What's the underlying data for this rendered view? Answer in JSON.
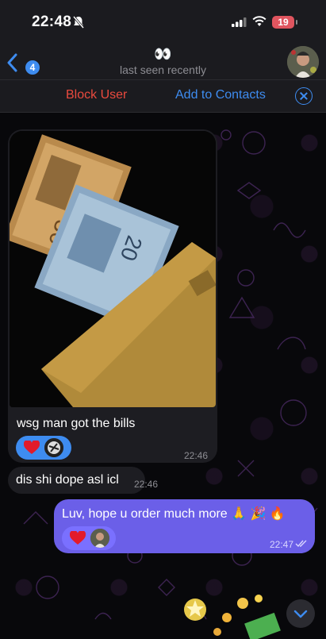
{
  "status_bar": {
    "time": "22:48",
    "battery": "19"
  },
  "nav": {
    "back_count": "4",
    "title": "👀",
    "subtitle": "last seen recently"
  },
  "action_bar": {
    "block_label": "Block User",
    "add_label": "Add to Contacts"
  },
  "messages": [
    {
      "caption": "wsg man got the bills",
      "time": "22:46",
      "reactions": [
        "heart",
        "avatar"
      ]
    },
    {
      "text": "dis shi dope asl icl",
      "time": "22:46"
    },
    {
      "text": "Luv, hope u order much more 🙏 🎉 🔥",
      "time": "22:47",
      "reactions": [
        "heart",
        "avatar"
      ]
    }
  ],
  "colors": {
    "accent": "#3e8cf0",
    "destructive": "#ea4a3e",
    "outgoing_bubble": "#6b5fe8",
    "incoming_bubble": "#1d1d22"
  },
  "icons": [
    "mute-icon",
    "signal-icon",
    "wifi-icon",
    "battery-icon",
    "back-chevron-icon",
    "close-icon",
    "heart-icon",
    "double-check-icon",
    "chevron-down-icon"
  ]
}
